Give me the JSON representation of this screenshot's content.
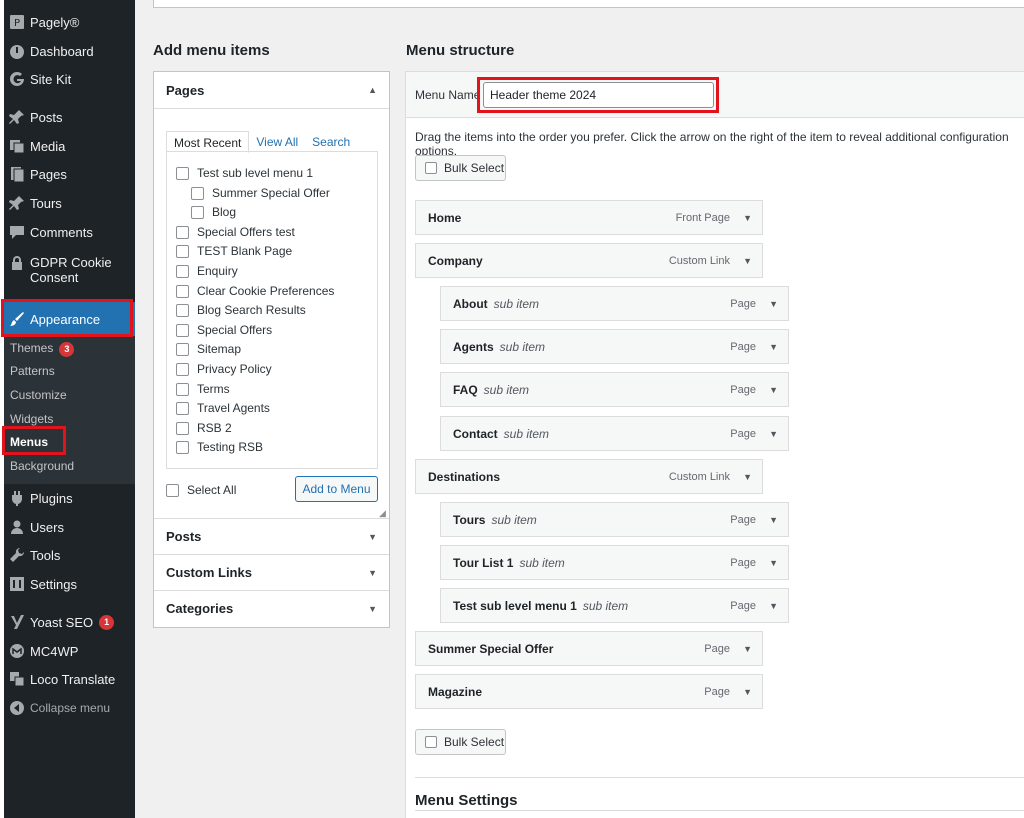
{
  "sidebar": {
    "items": [
      {
        "label": "Pagely®",
        "icon": "pagely-icon"
      },
      {
        "label": "Dashboard",
        "icon": "dashboard-icon"
      },
      {
        "label": "Site Kit",
        "icon": "sitekit-icon"
      },
      {
        "label": "Posts",
        "icon": "pin-icon"
      },
      {
        "label": "Media",
        "icon": "media-icon"
      },
      {
        "label": "Pages",
        "icon": "pages-icon"
      },
      {
        "label": "Tours",
        "icon": "pin-icon"
      },
      {
        "label": "Comments",
        "icon": "comments-icon"
      },
      {
        "label": "GDPR Cookie Consent",
        "icon": "lock-icon"
      },
      {
        "label": "Appearance",
        "icon": "brush-icon"
      },
      {
        "label": "Plugins",
        "icon": "plugins-icon"
      },
      {
        "label": "Users",
        "icon": "users-icon"
      },
      {
        "label": "Tools",
        "icon": "tools-icon"
      },
      {
        "label": "Settings",
        "icon": "settings-icon"
      },
      {
        "label": "Yoast SEO",
        "icon": "yoast-icon",
        "badge": "1"
      },
      {
        "label": "MC4WP",
        "icon": "mc4wp-icon"
      },
      {
        "label": "Loco Translate",
        "icon": "translate-icon"
      }
    ],
    "submenu": [
      {
        "label": "Themes",
        "badge": "3"
      },
      {
        "label": "Patterns"
      },
      {
        "label": "Customize"
      },
      {
        "label": "Widgets"
      },
      {
        "label": "Menus"
      },
      {
        "label": "Background"
      }
    ],
    "collapse_label": "Collapse menu"
  },
  "add_items": {
    "heading": "Add menu items",
    "pages_label": "Pages",
    "tabs": [
      "Most Recent",
      "View All",
      "Search"
    ],
    "pages": [
      "Test sub level menu 1",
      "Summer Special Offer",
      "Blog",
      "Special Offers test",
      "TEST Blank Page",
      "Enquiry",
      "Clear Cookie Preferences",
      "Blog Search Results",
      "Special Offers",
      "Sitemap",
      "Privacy Policy",
      "Terms",
      "Travel Agents",
      "RSB 2",
      "Testing RSB"
    ],
    "select_all": "Select All",
    "add_button": "Add to Menu",
    "sections": [
      "Posts",
      "Custom Links",
      "Categories"
    ]
  },
  "structure": {
    "heading": "Menu structure",
    "menu_name_label": "Menu Name",
    "menu_name_value": "Header theme 2024",
    "instructions": "Drag the items into the order you prefer. Click the arrow on the right of the item to reveal additional configuration options.",
    "bulk_select": "Bulk Select",
    "sub_item_label": "sub item",
    "items": [
      {
        "title": "Home",
        "type": "Front Page",
        "level": 0
      },
      {
        "title": "Company",
        "type": "Custom Link",
        "level": 0
      },
      {
        "title": "About",
        "type": "Page",
        "level": 1
      },
      {
        "title": "Agents",
        "type": "Page",
        "level": 1
      },
      {
        "title": "FAQ",
        "type": "Page",
        "level": 1
      },
      {
        "title": "Contact",
        "type": "Page",
        "level": 1
      },
      {
        "title": "Destinations",
        "type": "Custom Link",
        "level": 0
      },
      {
        "title": "Tours",
        "type": "Page",
        "level": 1
      },
      {
        "title": "Tour List 1",
        "type": "Page",
        "level": 1
      },
      {
        "title": "Test sub level menu 1",
        "type": "Page",
        "level": 1
      },
      {
        "title": "Summer Special Offer",
        "type": "Page",
        "level": 0
      },
      {
        "title": "Magazine",
        "type": "Page",
        "level": 0
      }
    ],
    "menu_settings": "Menu Settings"
  },
  "colors": {
    "sidebar_bg": "#1d2327",
    "accent": "#2271b1",
    "highlight": "#e3131b",
    "badge": "#d63638"
  }
}
